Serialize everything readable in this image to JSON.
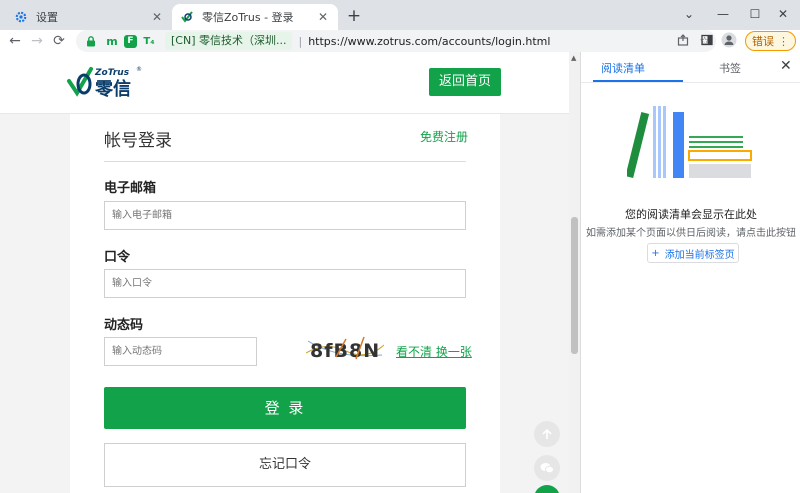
{
  "browser": {
    "tabs": [
      {
        "title": "设置",
        "icon": "gear-icon",
        "close": "✕"
      },
      {
        "title": "零信ZoTrus - 登录",
        "icon": "zotrus-favicon-icon",
        "close": "✕"
      }
    ],
    "new_tab": "+",
    "window_controls": {
      "collapse": "⌄",
      "minimize": "—",
      "maximize": "☐",
      "close": "✕"
    },
    "nav": {
      "back": "←",
      "forward": "→",
      "reload": "⟳"
    },
    "extensions": [
      {
        "icon": "lock-icon",
        "glyph": "🔒"
      },
      {
        "icon": "m-extension-icon",
        "glyph": "m"
      },
      {
        "icon": "f-extension-icon",
        "glyph": "F"
      },
      {
        "icon": "translate-extension-icon",
        "glyph": "T₄"
      }
    ],
    "ev_badge": "[CN] 零信技术（深圳...",
    "url": "https://www.zotrus.com/accounts/login.html",
    "error_button": "错误",
    "accent_green": "#12a34a",
    "accent_blue": "#1a73e8"
  },
  "site": {
    "logo_text_top": "ZoTrus",
    "logo_reg": "®",
    "logo_text_cn": "零信",
    "home_button": "返回首页"
  },
  "login": {
    "title": "帐号登录",
    "register_link": "免费注册",
    "email_label": "电子邮箱",
    "email_placeholder": "输入电子邮箱",
    "password_label": "口令",
    "password_placeholder": "输入口令",
    "code_label": "动态码",
    "code_placeholder": "输入动态码",
    "captcha_text": "8fB8N",
    "captcha_refresh": "看不清 换一张",
    "submit_button": "登 录",
    "forgot_button": "忘记口令"
  },
  "side_panel": {
    "tab_reading_list": "阅读清单",
    "tab_bookmarks": "书签",
    "close": "✕",
    "empty_title": "您的阅读清单会显示在此处",
    "empty_subtitle": "如需添加某个页面以供日后阅读，请点击此按钮",
    "add_button": "添加当前标签页",
    "add_icon": "+"
  }
}
